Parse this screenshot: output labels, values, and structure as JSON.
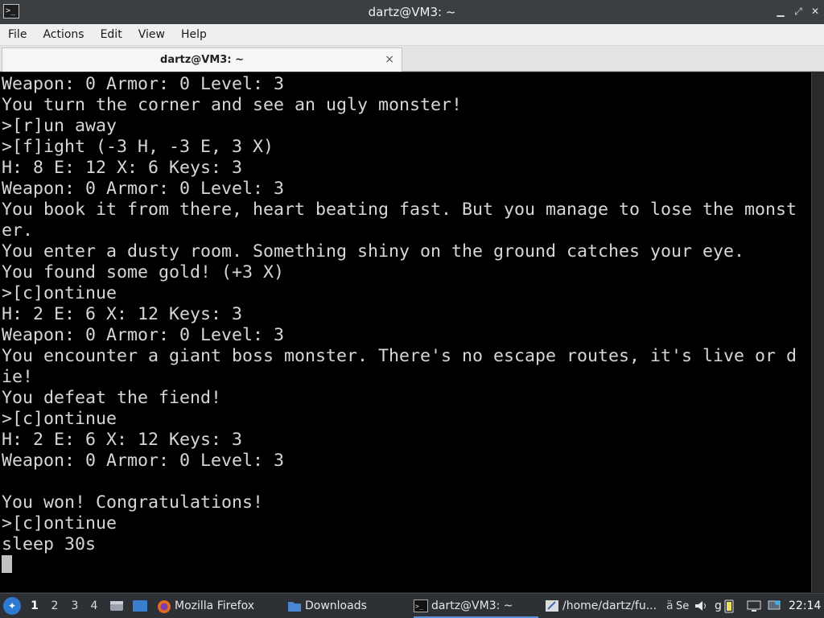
{
  "window": {
    "title": "dartz@VM3: ~"
  },
  "menu": [
    "File",
    "Actions",
    "Edit",
    "View",
    "Help"
  ],
  "tab": {
    "label": "dartz@VM3: ~",
    "close_glyph": "×"
  },
  "terminal": {
    "lines": [
      "Weapon: 0 Armor: 0 Level: 3",
      "You turn the corner and see an ugly monster!",
      ">[r]un away",
      ">[f]ight (-3 H, -3 E, 3 X)",
      "H: 8 E: 12 X: 6 Keys: 3",
      "Weapon: 0 Armor: 0 Level: 3",
      "You book it from there, heart beating fast. But you manage to lose the monst",
      "er.",
      "You enter a dusty room. Something shiny on the ground catches your eye.",
      "You found some gold! (+3 X)",
      ">[c]ontinue",
      "H: 2 E: 6 X: 12 Keys: 3",
      "Weapon: 0 Armor: 0 Level: 3",
      "You encounter a giant boss monster. There's no escape routes, it's live or d",
      "ie!",
      "You defeat the fiend!",
      ">[c]ontinue",
      "H: 2 E: 6 X: 12 Keys: 3",
      "Weapon: 0 Armor: 0 Level: 3",
      "",
      "You won! Congratulations!",
      ">[c]ontinue",
      "sleep 30s"
    ]
  },
  "taskbar": {
    "workspaces": [
      "1",
      "2",
      "3",
      "4"
    ],
    "active_workspace": "1",
    "tasks": [
      {
        "label": "Mozilla Firefox",
        "icon": "firefox-icon"
      },
      {
        "label": "Downloads",
        "icon": "folder-icon"
      },
      {
        "label": "dartz@VM3: ~",
        "icon": "terminal-icon"
      },
      {
        "label": "/home/dartz/fu...",
        "icon": "editor-icon"
      }
    ],
    "tray_partial_1": "Se",
    "tray_partial_2": "g",
    "clock": "22:14"
  }
}
